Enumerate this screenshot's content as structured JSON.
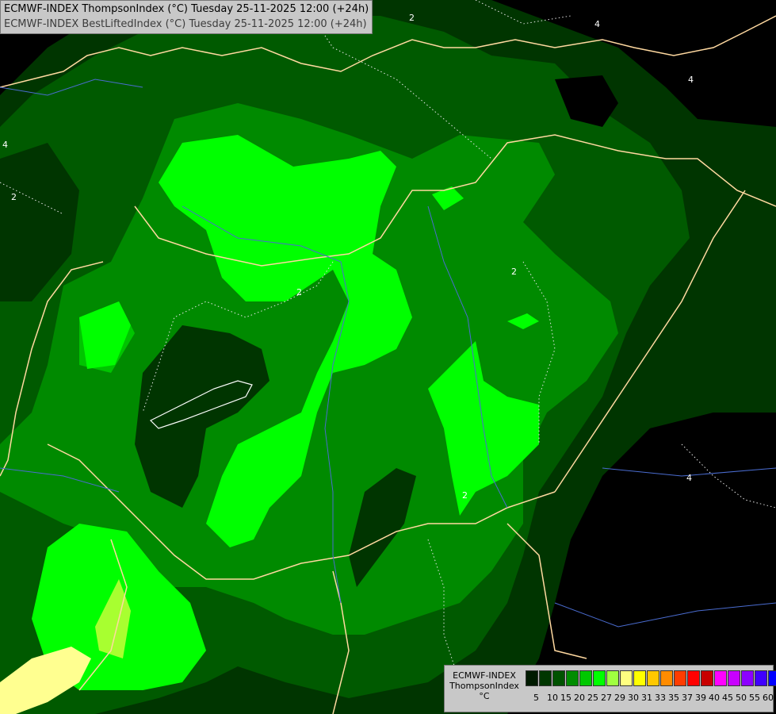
{
  "header": {
    "line1": "ECMWF-INDEX ThompsonIndex (°C) Tuesday 25-11-2025 12:00 (+24h)",
    "line2": "ECMWF-INDEX BestLiftedIndex (°C) Tuesday 25-11-2025 12:00 (+24h)"
  },
  "contour_labels": {
    "n2_north": "2",
    "n4_northeast": "4",
    "n4_east": "4",
    "n4_west": "4",
    "n2_west": "2",
    "n2_center": "2",
    "n2_central_east": "2",
    "n4_southeast": "4",
    "n2_south": "2"
  },
  "legend": {
    "line1": "ECMWF-INDEX",
    "line2": "ThompsonIndex",
    "line3": "°C",
    "colors": [
      "#000000",
      "#000000",
      "#001a00",
      "#003600",
      "#005200",
      "#008c00",
      "#00c800",
      "#00ff00",
      "#a0ff40",
      "#ffff80",
      "#ffff00",
      "#ffc800",
      "#ff8c00",
      "#ff3c00",
      "#ff0000",
      "#c80000",
      "#ff00ff",
      "#c800ff",
      "#8c00ff",
      "#4000ff",
      "#0000ff"
    ],
    "ticks": [
      "5",
      "10",
      "15",
      "20",
      "25",
      "27",
      "29",
      "30",
      "31",
      "33",
      "35",
      "37",
      "39",
      "40",
      "45",
      "50",
      "55",
      "60"
    ]
  },
  "palette": {
    "black": "#000000",
    "dark_green": "#003500",
    "mid_green": "#005a00",
    "green": "#008a00",
    "bright_green": "#00c400",
    "lime": "#00ff00",
    "yellow_green": "#a8ff30",
    "pale_yellow": "#ffff90",
    "border": "#ffd9a0",
    "river": "#4a6cd0"
  }
}
